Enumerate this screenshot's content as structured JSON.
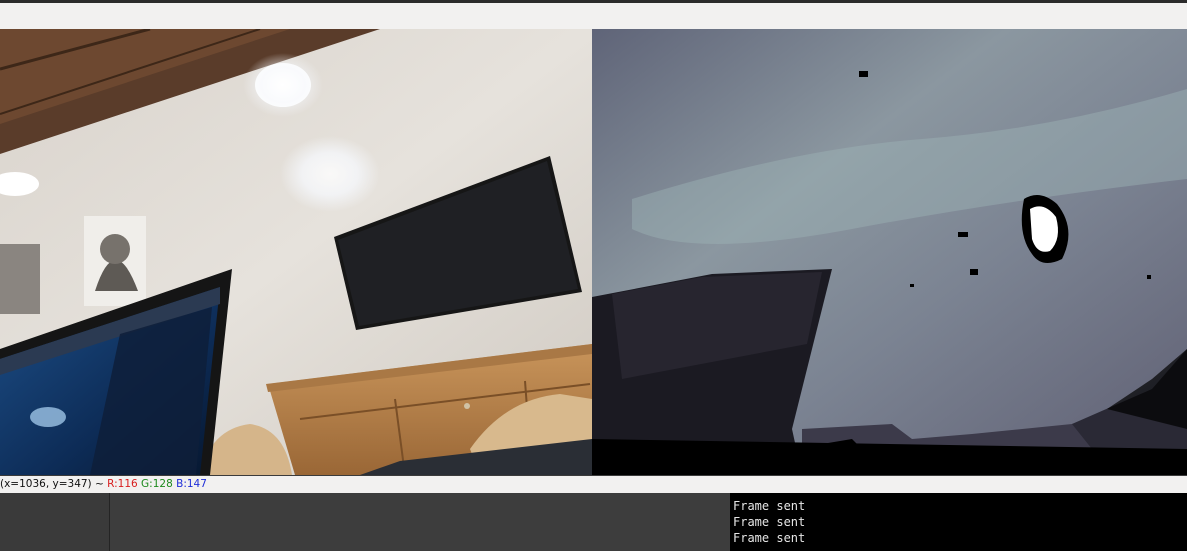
{
  "status_bar": {
    "coords": "(x=1036, y=347) ~",
    "r": "R:116",
    "g": "G:128",
    "b": "B:147"
  },
  "terminal": {
    "lines": [
      "Frame sent",
      "Frame sent",
      "Frame sent"
    ]
  },
  "views": {
    "left": "rgb-camera-image",
    "right": "depth-map-image"
  }
}
